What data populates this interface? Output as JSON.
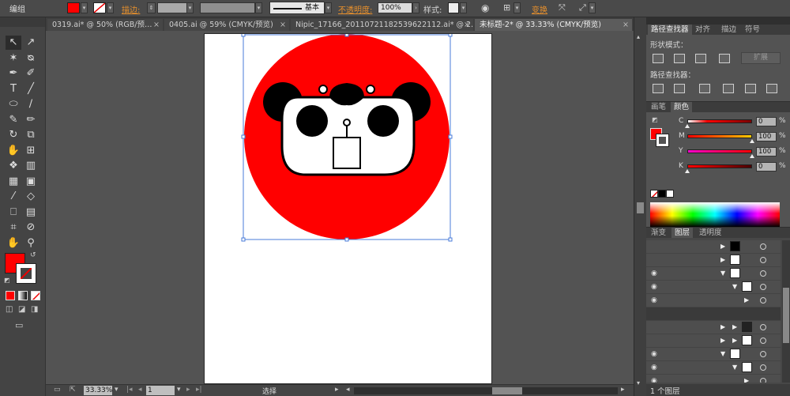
{
  "control_bar": {
    "group_label": "编组",
    "stroke_label": "描边:",
    "brush_label": "基本",
    "opacity_label": "不透明度:",
    "opacity_value": "100%",
    "style_label": "样式:",
    "transform_label": "变换",
    "fill_color": "#ff0000"
  },
  "tabs": [
    {
      "label": "0319.ai* @ 50% (RGB/预…",
      "close": "×"
    },
    {
      "label": "0405.ai @ 59% (CMYK/预览)",
      "close": "×"
    },
    {
      "label": "Nipic_17166_20110721182539622112.ai* @ 2…",
      "close": "×"
    },
    {
      "label": "未标题-2* @ 33.33% (CMYK/预览)",
      "close": "×"
    }
  ],
  "tools": [
    "↖",
    "↗",
    "✶",
    "ᴓ",
    "✒",
    "✐",
    "T",
    "╱",
    "⬭",
    "∕",
    "✎",
    "✏",
    "↻",
    "⧉",
    "✋",
    "⊞",
    "❖",
    "▥",
    "▦",
    "▣",
    "⁄",
    "◇",
    "⎕",
    "▤",
    "⌗",
    "⊘",
    "✋",
    "⚲"
  ],
  "status": {
    "zoom": "33.33%",
    "page": "1",
    "tool_name": "选择"
  },
  "pathfinder": {
    "tabs": [
      "路径查找器",
      "对齐",
      "描边",
      "符号"
    ],
    "shape_modes_label": "形状模式：",
    "expand_label": "扩展",
    "pathfinders_label": "路径查找器："
  },
  "color_panel": {
    "tabs": [
      "画笔",
      "颜色"
    ],
    "channels": [
      {
        "letter": "C",
        "value": "0",
        "level": 0,
        "gradient": "linear-gradient(90deg,#fff,#ff0000 30%,#7a0000)"
      },
      {
        "letter": "M",
        "value": "100",
        "level": 100,
        "gradient": "linear-gradient(90deg,#ff0000,#ffcc00)"
      },
      {
        "letter": "Y",
        "value": "100",
        "level": 100,
        "gradient": "linear-gradient(90deg,#ff00cc,#ff0000)"
      },
      {
        "letter": "K",
        "value": "0",
        "level": 0,
        "gradient": "linear-gradient(90deg,#ff0000,#4a0000)"
      }
    ],
    "percent": "%"
  },
  "layers_panel": {
    "tabs": [
      "渐变",
      "图层",
      "透明度"
    ],
    "layer_count": "1 个图层"
  },
  "colors": {
    "accent_red": "#ff0000",
    "selection_blue": "#4a7bd8"
  }
}
